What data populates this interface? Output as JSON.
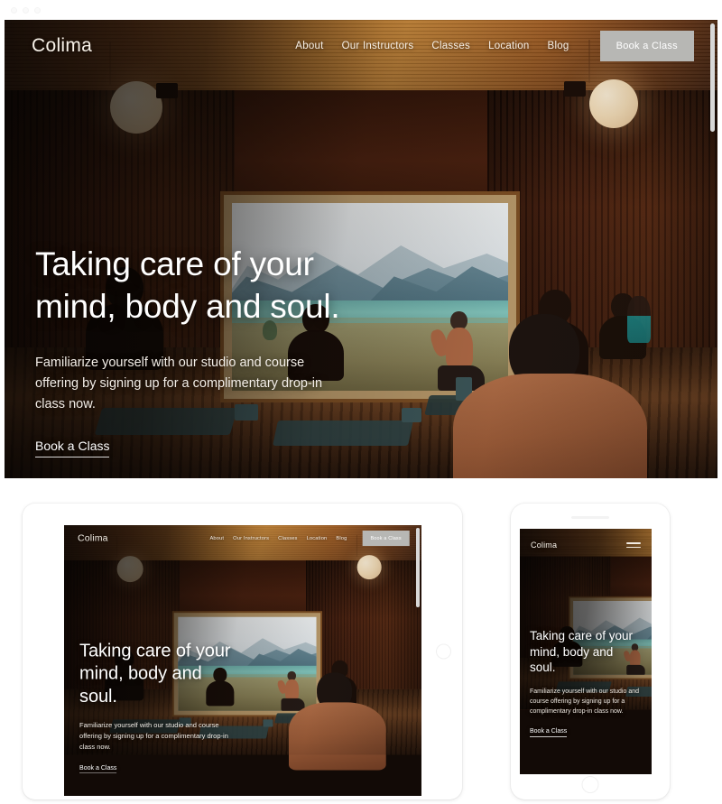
{
  "browser": {
    "window_controls": [
      "close",
      "minimize",
      "maximize"
    ]
  },
  "site": {
    "brand": "Colima",
    "nav": [
      {
        "label": "About"
      },
      {
        "label": "Our Instructors"
      },
      {
        "label": "Classes"
      },
      {
        "label": "Location"
      },
      {
        "label": "Blog"
      }
    ],
    "nav_cta": "Book a Class",
    "hero": {
      "title_line_1": "Taking care of your",
      "title_line_2": "mind, body and soul.",
      "title_full": "Taking care of your mind, body and soul.",
      "subtitle": "Familiarize yourself with our studio and course offering by signing up for a complimentary drop-in class now.",
      "cta": "Book a Class"
    }
  },
  "previews": {
    "tablet": {
      "brand": "Colima",
      "nav": [
        {
          "label": "About"
        },
        {
          "label": "Our Instructors"
        },
        {
          "label": "Classes"
        },
        {
          "label": "Location"
        },
        {
          "label": "Blog"
        }
      ],
      "nav_cta": "Book a Class",
      "title": "Taking care of your mind, body and soul.",
      "subtitle": "Familiarize yourself with our studio and course offering by signing up for a complimentary drop-in class now.",
      "cta": "Book a Class"
    },
    "phone": {
      "brand": "Colima",
      "menu_icon": "hamburger-icon",
      "title": "Taking care of your mind, body and soul.",
      "subtitle": "Familiarize yourself with our studio and course offering by signing up for a complimentary drop-in class now.",
      "cta": "Book a Class"
    }
  },
  "theme": {
    "page_background": "#ffffff",
    "ceiling_warm": "#c8812f",
    "wall_wood": "#4d2211",
    "button_grey": "#b7b7b4",
    "text_on_hero": "#ffffff",
    "lamp_glow": "#f6dfb9",
    "lake_teal": "#83c6bd",
    "mountain_blue": "#5f8290",
    "scrollbar": "#d8d8d8"
  }
}
